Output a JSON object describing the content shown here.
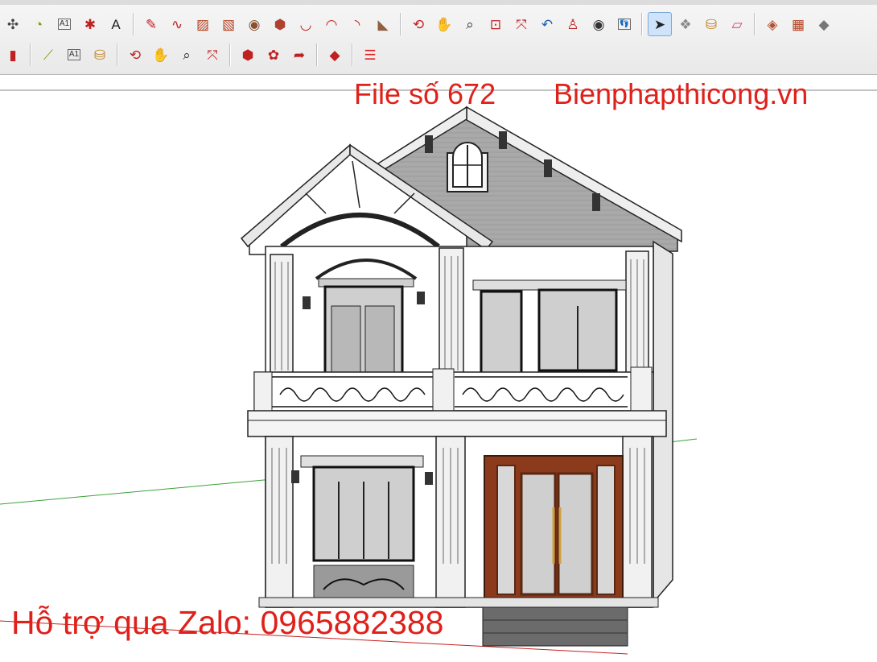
{
  "toolbar": {
    "row1": [
      {
        "name": "axes-tool-icon",
        "glyph": "✣",
        "color": "#444"
      },
      {
        "name": "protractor-tool-icon",
        "glyph": "◔",
        "color": "#8a9a10"
      },
      {
        "name": "text-tool-icon",
        "glyph": "A1",
        "color": "#333"
      },
      {
        "name": "axes-icon",
        "glyph": "✱",
        "color": "#c02020"
      },
      {
        "name": "3d-text-icon",
        "glyph": "A",
        "color": "#222"
      },
      {
        "sep": true
      },
      {
        "name": "pencil-line-icon",
        "glyph": "✎",
        "color": "#c02020"
      },
      {
        "name": "freehand-icon",
        "glyph": "∿",
        "color": "#c02020"
      },
      {
        "name": "rectangle-icon",
        "glyph": "▨",
        "color": "#b04020"
      },
      {
        "name": "rotated-rectangle-icon",
        "glyph": "▧",
        "color": "#b04020"
      },
      {
        "name": "circle-icon",
        "glyph": "◉",
        "color": "#8a5030"
      },
      {
        "name": "polygon-icon",
        "glyph": "⬢",
        "color": "#b04030"
      },
      {
        "name": "arc-icon",
        "glyph": "◡",
        "color": "#c02020"
      },
      {
        "name": "two-point-arc-icon",
        "glyph": "◠",
        "color": "#c02020"
      },
      {
        "name": "three-point-arc-icon",
        "glyph": "◝",
        "color": "#c02020"
      },
      {
        "name": "pie-icon",
        "glyph": "◣",
        "color": "#906040"
      },
      {
        "sep": true
      },
      {
        "name": "orbit-icon",
        "glyph": "⟲",
        "color": "#c02020"
      },
      {
        "name": "pan-icon",
        "glyph": "✋",
        "color": "#c89020"
      },
      {
        "name": "zoom-icon",
        "glyph": "⌕",
        "color": "#333"
      },
      {
        "name": "zoom-window-icon",
        "glyph": "⊡",
        "color": "#c02020"
      },
      {
        "name": "zoom-extents-icon",
        "glyph": "⤧",
        "color": "#c02020"
      },
      {
        "name": "previous-view-icon",
        "glyph": "↶",
        "color": "#2060b0"
      },
      {
        "name": "position-camera-icon",
        "glyph": "♙",
        "color": "#c02020"
      },
      {
        "name": "look-around-icon",
        "glyph": "◉",
        "color": "#333"
      },
      {
        "name": "walk-icon",
        "glyph": "👣",
        "color": "#333"
      },
      {
        "sep": true
      },
      {
        "name": "select-arrow-icon",
        "glyph": "➤",
        "color": "#222",
        "active": true
      },
      {
        "name": "make-component-icon",
        "glyph": "❖",
        "color": "#888"
      },
      {
        "name": "paint-bucket-icon",
        "glyph": "⛁",
        "color": "#c08020"
      },
      {
        "name": "eraser-icon",
        "glyph": "▱",
        "color": "#d04070"
      },
      {
        "sep": true
      },
      {
        "name": "sandbox-icon",
        "glyph": "◈",
        "color": "#b05030"
      },
      {
        "name": "grid-icon",
        "glyph": "▦",
        "color": "#b04020"
      },
      {
        "name": "more-tools-icon",
        "glyph": "◆",
        "color": "#777"
      }
    ],
    "row2": [
      {
        "name": "push-pull-icon",
        "glyph": "▮",
        "color": "#c02020"
      },
      {
        "sep": true
      },
      {
        "name": "tape-measure-icon",
        "glyph": "⟋",
        "color": "#8a9a10"
      },
      {
        "name": "dimension-text-icon",
        "glyph": "A1",
        "color": "#333"
      },
      {
        "name": "paint-icon",
        "glyph": "⛁",
        "color": "#c08020"
      },
      {
        "sep": true
      },
      {
        "name": "orbit-small-icon",
        "glyph": "⟲",
        "color": "#c02020"
      },
      {
        "name": "pan-small-icon",
        "glyph": "✋",
        "color": "#c89020"
      },
      {
        "name": "zoom-small-icon",
        "glyph": "⌕",
        "color": "#333"
      },
      {
        "name": "zoom-extents-small-icon",
        "glyph": "⤧",
        "color": "#c02020"
      },
      {
        "sep": true
      },
      {
        "name": "warehouse-icon",
        "glyph": "⬢",
        "color": "#c02020"
      },
      {
        "name": "components-icon",
        "glyph": "✿",
        "color": "#c02020"
      },
      {
        "name": "share-model-icon",
        "glyph": "➦",
        "color": "#c02020"
      },
      {
        "sep": true
      },
      {
        "name": "ruby-extension-icon",
        "glyph": "◆",
        "color": "#c02020"
      },
      {
        "sep": true
      },
      {
        "name": "layers-icon",
        "glyph": "☰",
        "color": "#e02020"
      }
    ]
  },
  "watermark": {
    "file_label": "File số 672",
    "site_label": "Bienphapthicong.vn",
    "support_label": "Hỗ trợ qua Zalo: 0965882388",
    "color": "#e0201a"
  }
}
